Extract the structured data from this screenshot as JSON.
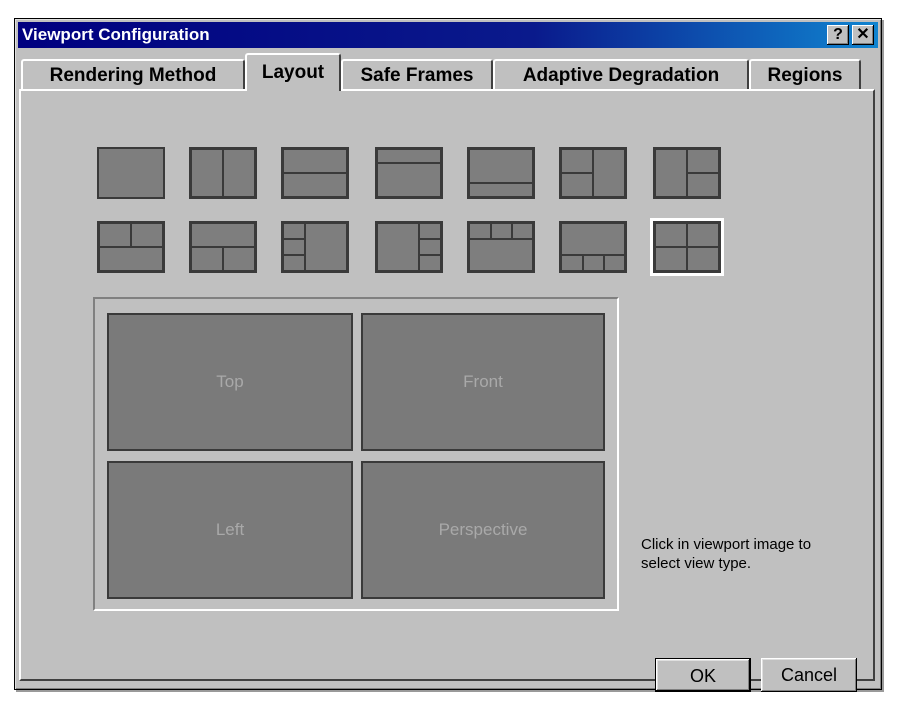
{
  "window": {
    "title": "Viewport Configuration",
    "help_label": "?",
    "close_label": "✕"
  },
  "tabs": [
    {
      "label": "Rendering Method",
      "active": false
    },
    {
      "label": "Layout",
      "active": true
    },
    {
      "label": "Safe Frames",
      "active": false
    },
    {
      "label": "Adaptive Degradation",
      "active": false
    },
    {
      "label": "Regions",
      "active": false
    }
  ],
  "layout_thumbnails_selected_index": 13,
  "viewports": {
    "top_left": "Top",
    "top_right": "Front",
    "bottom_left": "Left",
    "bottom_right": "Perspective"
  },
  "hint_text": "Click in viewport image to select view type.",
  "buttons": {
    "ok": "OK",
    "cancel": "Cancel"
  }
}
